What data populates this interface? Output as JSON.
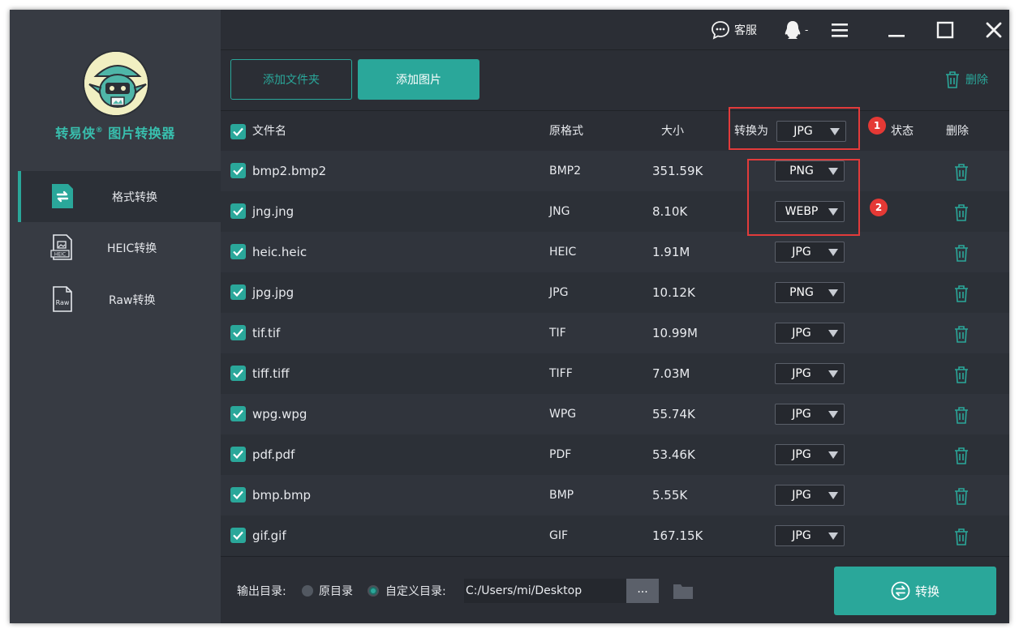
{
  "app": {
    "title": "转易侠",
    "title_mark": "®",
    "title_suffix": " 图片转换器"
  },
  "titlebar": {
    "service_label": "客服",
    "user_label": "-"
  },
  "sidebar": {
    "items": [
      {
        "label": "格式转换",
        "icon": "format-convert-icon",
        "active": true
      },
      {
        "label": "HEIC转换",
        "icon": "heic-file-icon",
        "active": false
      },
      {
        "label": "Raw转换",
        "icon": "raw-file-icon",
        "active": false
      }
    ]
  },
  "toolbar": {
    "add_folder": "添加文件夹",
    "add_image": "添加图片",
    "delete": "删除"
  },
  "table": {
    "headers": {
      "filename": "文件名",
      "orig_format": "原格式",
      "size": "大小",
      "convert_to": "转换为",
      "convert_to_value": "JPG",
      "status": "状态",
      "delete": "删除"
    },
    "rows": [
      {
        "name": "bmp2.bmp2",
        "format": "BMP2",
        "size": "351.59K",
        "target": "PNG"
      },
      {
        "name": "jng.jng",
        "format": "JNG",
        "size": "8.10K",
        "target": "WEBP"
      },
      {
        "name": "heic.heic",
        "format": "HEIC",
        "size": "1.91M",
        "target": "JPG"
      },
      {
        "name": "jpg.jpg",
        "format": "JPG",
        "size": "10.12K",
        "target": "PNG"
      },
      {
        "name": "tif.tif",
        "format": "TIF",
        "size": "10.99M",
        "target": "JPG"
      },
      {
        "name": "tiff.tiff",
        "format": "TIFF",
        "size": "7.03M",
        "target": "JPG"
      },
      {
        "name": "wpg.wpg",
        "format": "WPG",
        "size": "55.74K",
        "target": "JPG"
      },
      {
        "name": "pdf.pdf",
        "format": "PDF",
        "size": "53.46K",
        "target": "JPG"
      },
      {
        "name": "bmp.bmp",
        "format": "BMP",
        "size": "5.55K",
        "target": "JPG"
      },
      {
        "name": "gif.gif",
        "format": "GIF",
        "size": "167.15K",
        "target": "JPG"
      }
    ]
  },
  "annotations": {
    "badge1": "1",
    "badge2": "2"
  },
  "footer": {
    "output_label": "输出目录:",
    "option_original": "原目录",
    "option_custom": "自定义目录:",
    "path": "C:/Users/mi/Desktop",
    "browse": "...",
    "convert": "转换"
  },
  "colors": {
    "accent": "#2aa79a",
    "highlight": "#e23b3b",
    "background": "#2b2e35"
  }
}
